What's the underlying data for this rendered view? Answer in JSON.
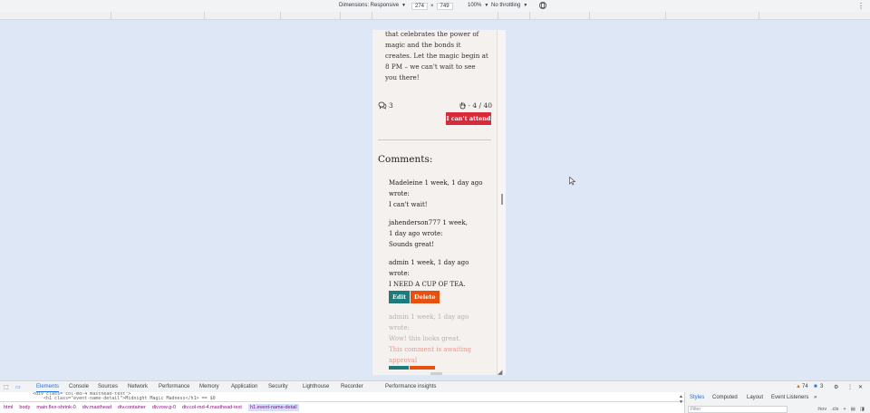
{
  "device_toolbar": {
    "dimensions": "Dimensions: Responsive",
    "width": "274",
    "times": "×",
    "height": "749",
    "zoom": "100%",
    "throttling": "No throttling"
  },
  "event": {
    "description_lines": [
      "that celebrates the power of",
      "magic and the bonds it",
      "creates. Let the magic begin at",
      "8 PM – we can't wait to see",
      "you there!"
    ],
    "comment_count": "3",
    "attendance": "· 4 / 40",
    "cant_attend_label": "I can't attend"
  },
  "comments": {
    "heading": "Comments:",
    "items": [
      {
        "author_line": "Madeleine 1 week, 1 day ago",
        "wrote": "wrote:",
        "body": "I can't wait!"
      },
      {
        "author_line": "jahenderson777 1 week,",
        "author_line2": "1 day ago wrote:",
        "body": "Sounds great!"
      },
      {
        "author_line": "admin 1 week, 1 day ago",
        "wrote": "wrote:",
        "body": "I NEED A CUP OF TEA.",
        "edit_label": "Edit",
        "delete_label": "Delete"
      },
      {
        "author_line": "admin 1 week, 1 day ago",
        "wrote": "wrote:",
        "body": "Wow! this looks great.",
        "awaiting_line1": "This comment is awaiting",
        "awaiting_line2": "approval"
      }
    ]
  },
  "devtools": {
    "tabs": [
      "Elements",
      "Console",
      "Sources",
      "Network",
      "Performance",
      "Memory",
      "Application",
      "Security",
      "Lighthouse",
      "Recorder",
      "Performance insights"
    ],
    "warnings": "74",
    "issues": "3",
    "code_line1": "<div class=\"col-md-4 masthead-text\">",
    "code_line2": "<h1 class=\"event-name-detail\">Midnight Magic Madness</h1> == $0",
    "breadcrumbs": [
      "html",
      "body",
      "main.flex-shrink-0",
      "div.masthead",
      "div.container",
      "div.row.g-0",
      "div.col-md-4.masthead-text",
      "h1.event-name-detail"
    ],
    "style_tabs": [
      "Styles",
      "Computed",
      "Layout",
      "Event Listeners",
      "»"
    ],
    "filter_placeholder": "Filter",
    "hov": ":hov",
    "cls": ".cls"
  },
  "colors": {
    "page_bg": "#dee7f5",
    "cant_attend": "#d72a3b",
    "edit": "#1f7a7b",
    "delete": "#e7510f",
    "devtools_accent": "#1a73e8"
  }
}
